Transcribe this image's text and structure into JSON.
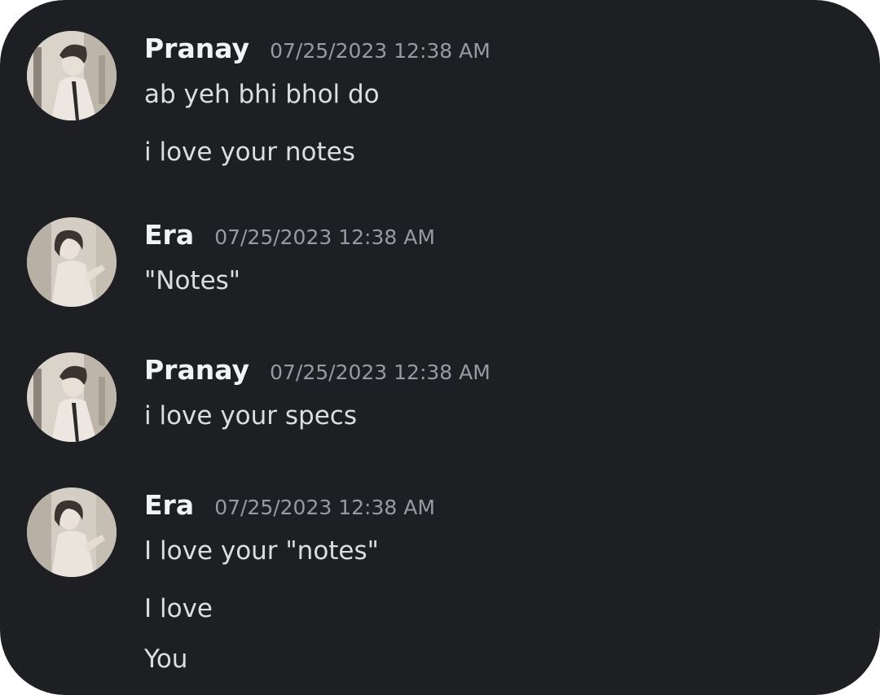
{
  "messages": [
    {
      "author": "Pranay",
      "timestamp": "07/25/2023 12:38 AM",
      "avatar_icon": "user-avatar-male",
      "lines": [
        "ab yeh bhi bhol do",
        "i love your notes"
      ]
    },
    {
      "author": "Era",
      "timestamp": "07/25/2023 12:38 AM",
      "avatar_icon": "user-avatar-female",
      "lines": [
        "\"Notes\""
      ]
    },
    {
      "author": "Pranay",
      "timestamp": "07/25/2023 12:38 AM",
      "avatar_icon": "user-avatar-male",
      "lines": [
        "i love your specs"
      ]
    },
    {
      "author": "Era",
      "timestamp": "07/25/2023 12:38 AM",
      "avatar_icon": "user-avatar-female",
      "lines": [
        "I love your \"notes\"",
        "I love",
        "You"
      ]
    }
  ],
  "colors": {
    "background": "#1e1f23",
    "author": "#f2f3f5",
    "timestamp": "#959ba3",
    "message_text": "#dbdee1"
  }
}
